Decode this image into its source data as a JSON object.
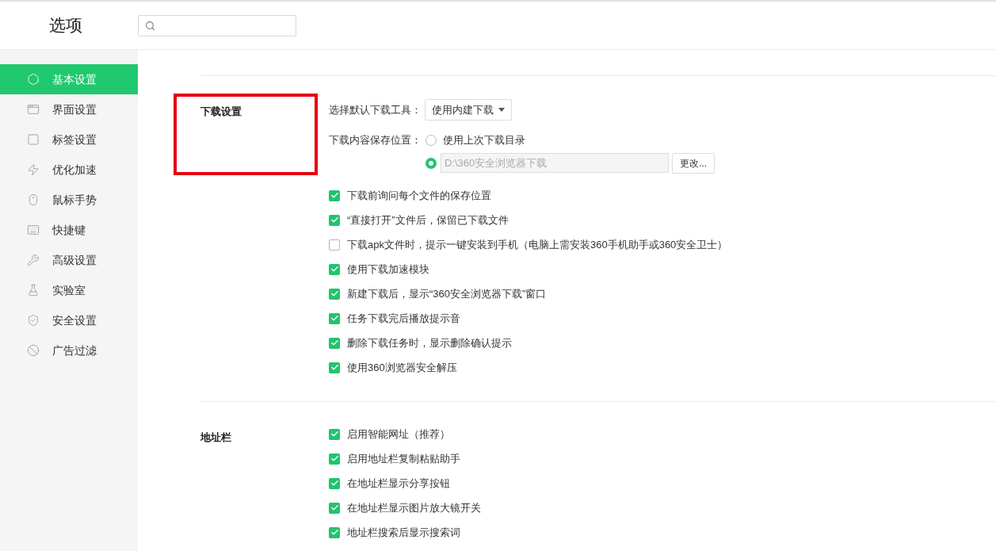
{
  "header": {
    "title": "选项"
  },
  "sidebar": {
    "items": [
      {
        "label": "基本设置",
        "selected": true
      },
      {
        "label": "界面设置",
        "selected": false
      },
      {
        "label": "标签设置",
        "selected": false
      },
      {
        "label": "优化加速",
        "selected": false
      },
      {
        "label": "鼠标手势",
        "selected": false
      },
      {
        "label": "快捷键",
        "selected": false
      },
      {
        "label": "高级设置",
        "selected": false
      },
      {
        "label": "实验室",
        "selected": false
      },
      {
        "label": "安全设置",
        "selected": false
      },
      {
        "label": "广告过滤",
        "selected": false
      }
    ]
  },
  "sections": [
    {
      "title": "下载设置",
      "highlighted": true,
      "rows": [
        {
          "kind": "select",
          "label": "选择默认下载工具：",
          "value": "使用内建下载"
        },
        {
          "kind": "radio_group",
          "label": "下载内容保存位置：",
          "options": [
            {
              "label": "使用上次下载目录",
              "selected": false
            },
            {
              "path": "D:\\360安全浏览器下载",
              "button": "更改...",
              "selected": true
            }
          ]
        },
        {
          "kind": "checkbox",
          "label": "下载前询问每个文件的保存位置",
          "checked": true
        },
        {
          "kind": "checkbox",
          "label": "“直接打开”文件后，保留已下载文件",
          "checked": true
        },
        {
          "kind": "checkbox",
          "label": "下载apk文件时，提示一键安装到手机（电脑上需安装360手机助手或360安全卫士）",
          "checked": false
        },
        {
          "kind": "checkbox",
          "label": "使用下载加速模块",
          "checked": true
        },
        {
          "kind": "checkbox",
          "label": "新建下载后，显示“360安全浏览器下载”窗口",
          "checked": true
        },
        {
          "kind": "checkbox",
          "label": "任务下载完后播放提示音",
          "checked": true
        },
        {
          "kind": "checkbox",
          "label": "删除下载任务时，显示删除确认提示",
          "checked": true
        },
        {
          "kind": "checkbox",
          "label": "使用360浏览器安全解压",
          "checked": true
        }
      ]
    },
    {
      "title": "地址栏",
      "highlighted": false,
      "rows": [
        {
          "kind": "checkbox",
          "label": "启用智能网址（推荐）",
          "checked": true
        },
        {
          "kind": "checkbox",
          "label": "启用地址栏复制粘贴助手",
          "checked": true
        },
        {
          "kind": "checkbox",
          "label": "在地址栏显示分享按钮",
          "checked": true
        },
        {
          "kind": "checkbox",
          "label": "在地址栏显示图片放大镜开关",
          "checked": true
        },
        {
          "kind": "checkbox",
          "label": "地址栏搜索后显示搜索词",
          "checked": true
        }
      ]
    }
  ]
}
